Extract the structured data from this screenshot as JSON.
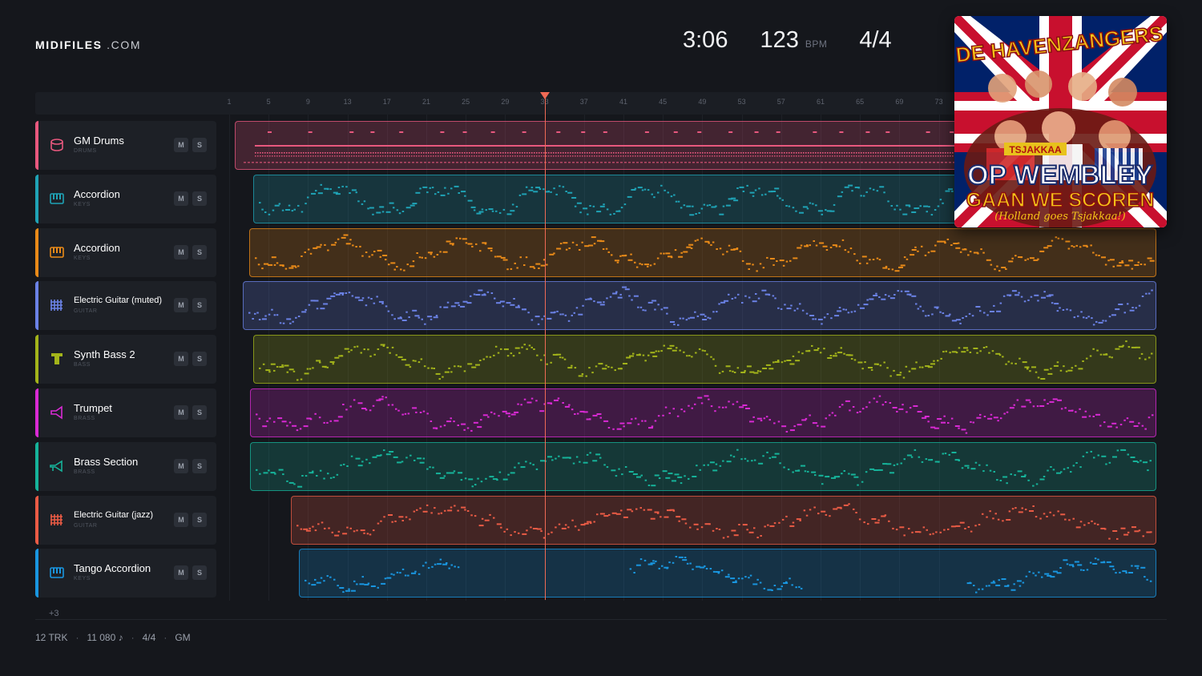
{
  "brand": {
    "name": "MIDIFILES",
    "suffix": ".COM"
  },
  "transport": {
    "duration": "3:06",
    "tempo": "123",
    "tempo_unit": "BPM",
    "meter": "4/4"
  },
  "ruler": {
    "ticks": [
      "1",
      "5",
      "9",
      "13",
      "17",
      "21",
      "25",
      "29",
      "33",
      "37",
      "41",
      "45",
      "49",
      "53",
      "57",
      "61",
      "65",
      "69",
      "73"
    ]
  },
  "playhead": {
    "bar": 33
  },
  "tracks": [
    {
      "name": "GM Drums",
      "category": "DRUMS",
      "mute": "M",
      "solo": "S",
      "color": "#e8587e",
      "icon": "drum-icon",
      "start_bar": 1.6
    },
    {
      "name": "Accordion",
      "category": "KEYS",
      "mute": "M",
      "solo": "S",
      "color": "#1fa3b6",
      "icon": "keyboard-icon",
      "start_bar": 3.4
    },
    {
      "name": "Accordion",
      "category": "KEYS",
      "mute": "M",
      "solo": "S",
      "color": "#e98a18",
      "icon": "keyboard-icon",
      "start_bar": 3.0
    },
    {
      "name": "Electric Guitar (muted)",
      "category": "GUITAR",
      "mute": "M",
      "solo": "S",
      "color": "#6b82e6",
      "icon": "guitar-icon",
      "start_bar": 2.4
    },
    {
      "name": "Synth Bass 2",
      "category": "BASS",
      "mute": "M",
      "solo": "S",
      "color": "#a3b41a",
      "icon": "bass-icon",
      "start_bar": 3.4
    },
    {
      "name": "Trumpet",
      "category": "BRASS",
      "mute": "M",
      "solo": "S",
      "color": "#d92ad4",
      "icon": "trumpet-icon",
      "start_bar": 3.1
    },
    {
      "name": "Brass Section",
      "category": "BRASS",
      "mute": "M",
      "solo": "S",
      "color": "#16b39a",
      "icon": "brass-icon",
      "start_bar": 3.1
    },
    {
      "name": "Electric Guitar (jazz)",
      "category": "GUITAR",
      "mute": "M",
      "solo": "S",
      "color": "#ea5b45",
      "icon": "guitar-icon",
      "start_bar": 7.3
    },
    {
      "name": "Tango Accordion",
      "category": "KEYS",
      "mute": "M",
      "solo": "S",
      "color": "#1996e0",
      "icon": "keyboard-icon",
      "start_bar": 8.1
    }
  ],
  "more_tracks": "+3",
  "footer": {
    "tracks": "12 TRK",
    "notes": "11 080 ♪",
    "meter": "4/4",
    "standard": "GM"
  },
  "cover": {
    "line1": "DE HAVENZANGERS",
    "line2": "OP WEMBLEY",
    "line3": "GAAN WE SCOREN",
    "line4": "(Holland goes Tsjakkaa!)",
    "badge": "TSJAKKAA"
  }
}
